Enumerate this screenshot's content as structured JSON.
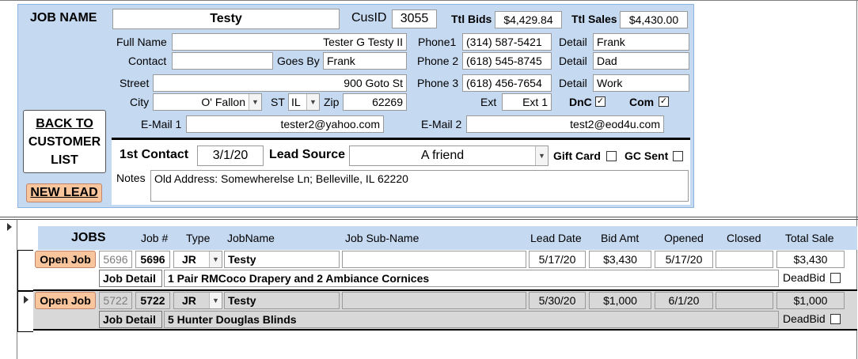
{
  "header": {
    "job_name_label": "JOB NAME",
    "job_name": "Testy",
    "cusid_label": "CusID",
    "cusid": "3055",
    "ttl_bids_label": "Ttl Bids",
    "ttl_bids": "$4,429.84",
    "ttl_sales_label": "Ttl Sales",
    "ttl_sales": "$4,430.00"
  },
  "nav": {
    "back_label_1": "BACK TO",
    "back_label_2": "CUSTOMER",
    "back_label_3": "LIST",
    "new_lead_label": "NEW LEAD"
  },
  "contact": {
    "full_name_label": "Full Name",
    "full_name": "Tester G Testy II",
    "contact_label": "Contact",
    "contact": "",
    "goes_by_label": "Goes By",
    "goes_by": "Frank",
    "street_label": "Street",
    "street": "900 Goto St",
    "city_label": "City",
    "city": "O' Fallon",
    "st_label": "ST",
    "st": "IL",
    "zip_label": "Zip",
    "zip": "62269",
    "email1_label": "E-Mail 1",
    "email1": "tester2@yahoo.com",
    "phone1_label": "Phone1",
    "phone1": "(314) 587-5421",
    "phone2_label": "Phone 2",
    "phone2": "(618) 545-8745",
    "phone3_label": "Phone 3",
    "phone3": "(618) 456-7654",
    "detail_label": "Detail",
    "detail1": "Frank",
    "detail2": "Dad",
    "detail3": "Work",
    "ext_label": "Ext",
    "ext": "Ext 1",
    "dnc_label": "DnC",
    "dnc_checked": true,
    "com_label": "Com",
    "com_checked": true,
    "email2_label": "E-Mail 2",
    "email2": "test2@eod4u.com"
  },
  "lead": {
    "first_contact_label": "1st Contact",
    "first_contact": "3/1/20",
    "lead_source_label": "Lead Source",
    "lead_source": "A friend",
    "gift_card_label": "Gift Card",
    "gift_card_checked": false,
    "gc_sent_label": "GC Sent",
    "gc_sent_checked": false,
    "notes_label": "Notes",
    "notes": "Old Address:  Somewherelse Ln; Belleville, IL  62220"
  },
  "jobs": {
    "title": "JOBS",
    "columns": {
      "job_num": "Job #",
      "type": "Type",
      "job_name": "JobName",
      "sub_name": "Job Sub-Name",
      "lead_date": "Lead Date",
      "bid_amt": "Bid Amt",
      "opened": "Opened",
      "closed": "Closed",
      "total_sale": "Total Sale"
    },
    "open_job_label": "Open Job",
    "job_detail_label": "Job Detail",
    "deadbid_label": "DeadBid",
    "rows": [
      {
        "id": "5696",
        "job_num": "5696",
        "type": "JR",
        "job_name": "Testy",
        "sub_name": "",
        "lead_date": "5/17/20",
        "bid_amt": "$3,430",
        "opened": "5/17/20",
        "closed": "",
        "total_sale": "$3,430",
        "detail": "1 Pair RMCoco Drapery and 2 Ambiance Cornices",
        "deadbid": false
      },
      {
        "id": "5722",
        "job_num": "5722",
        "type": "JR",
        "job_name": "Testy",
        "sub_name": "",
        "lead_date": "5/30/20",
        "bid_amt": "$1,000",
        "opened": "6/1/20",
        "closed": "",
        "total_sale": "$1,000",
        "detail": "5 Hunter Douglas Blinds",
        "deadbid": false
      }
    ]
  },
  "colors": {
    "panel_bg": "#c5d9f1",
    "panel_border": "#8db3e2",
    "row_bg": "#d8d8d8",
    "button_peach": "#f9c59c"
  }
}
